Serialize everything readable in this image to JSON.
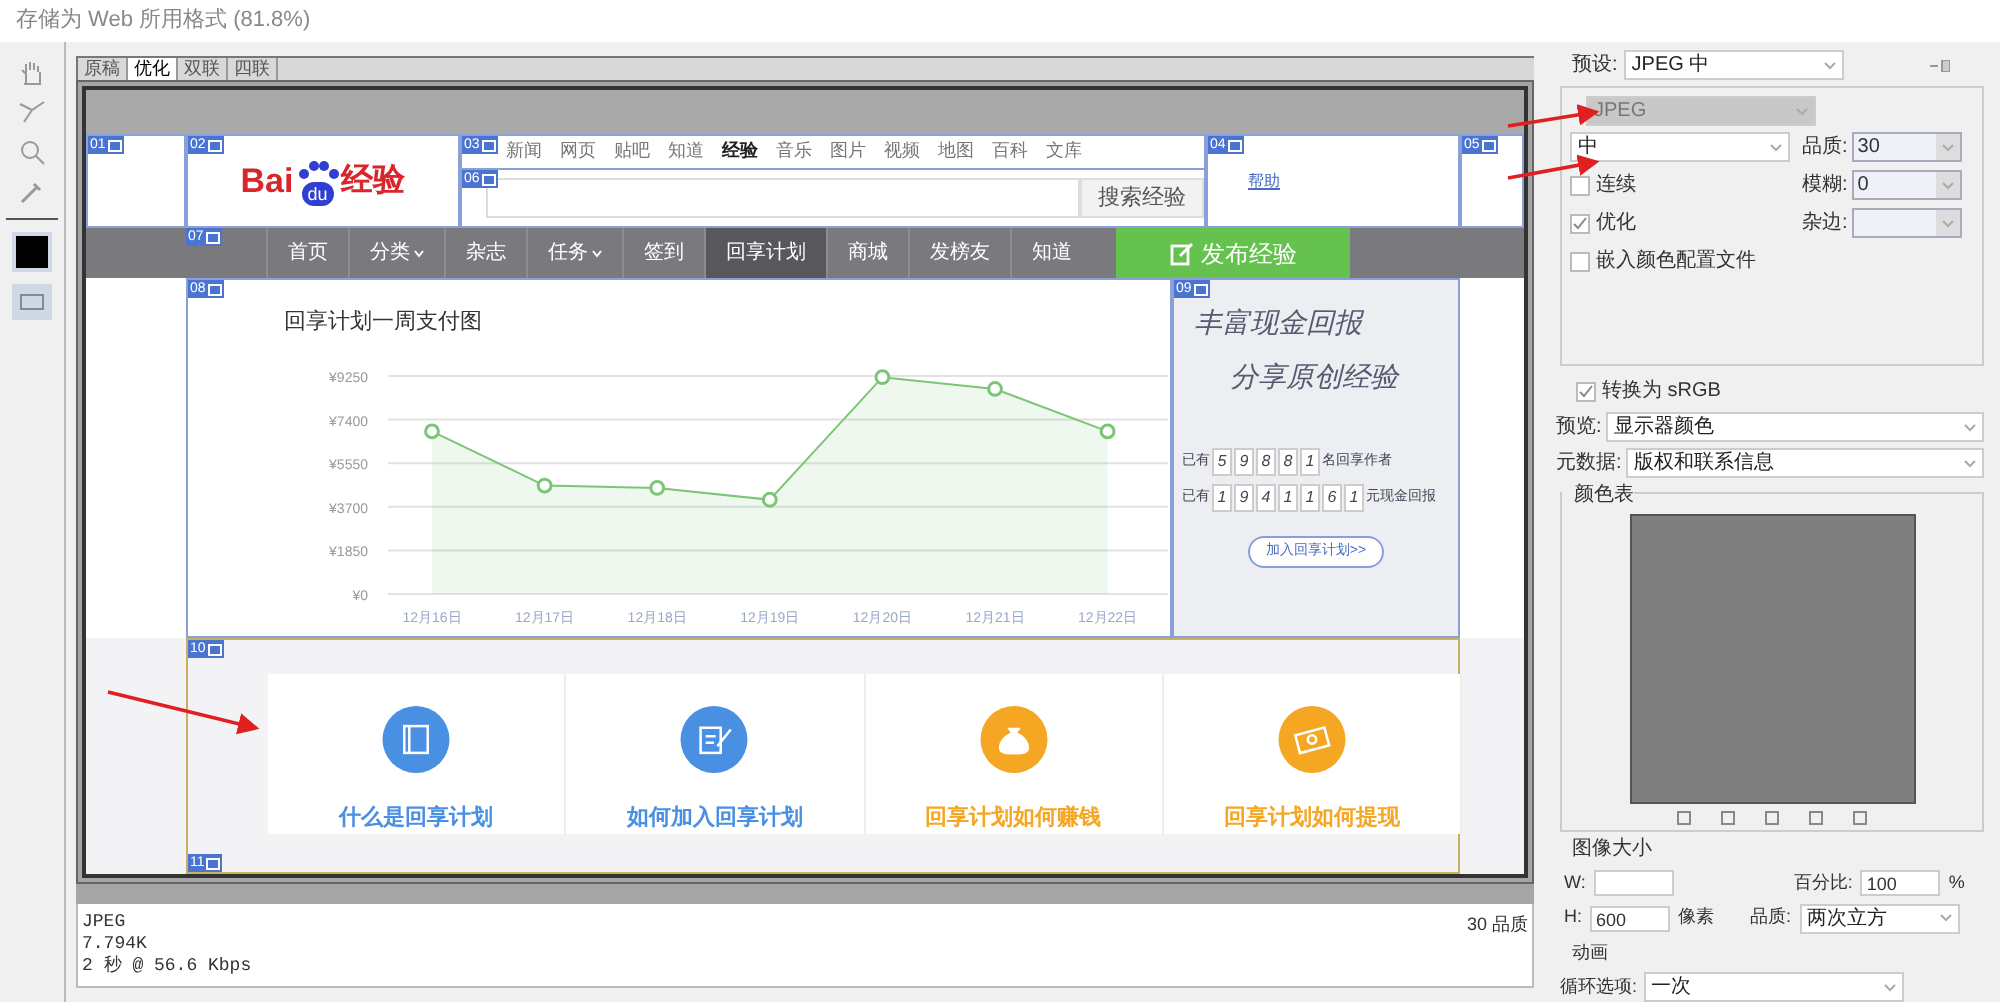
{
  "window": {
    "title": "存储为 Web 所用格式 (81.8%)"
  },
  "view_tabs": [
    {
      "label": "原稿",
      "selected": false
    },
    {
      "label": "优化",
      "selected": true
    },
    {
      "label": "双联",
      "selected": false
    },
    {
      "label": "四联",
      "selected": false
    }
  ],
  "slices": [
    "01",
    "02",
    "03",
    "06",
    "07",
    "08",
    "04",
    "05",
    "09",
    "10",
    "11"
  ],
  "page": {
    "logo": {
      "left": "Bai",
      "mark": "du",
      "right": "经验"
    },
    "top_links": [
      {
        "label": "新闻",
        "selected": false
      },
      {
        "label": "网页",
        "selected": false
      },
      {
        "label": "贴吧",
        "selected": false
      },
      {
        "label": "知道",
        "selected": false
      },
      {
        "label": "经验",
        "selected": true
      },
      {
        "label": "音乐",
        "selected": false
      },
      {
        "label": "图片",
        "selected": false
      },
      {
        "label": "视频",
        "selected": false
      },
      {
        "label": "地图",
        "selected": false
      },
      {
        "label": "百科",
        "selected": false
      },
      {
        "label": "文库",
        "selected": false
      }
    ],
    "search_button": "搜索经验",
    "help_link": "帮助",
    "nav": [
      {
        "label": "首页",
        "selected": false,
        "dropdown": false
      },
      {
        "label": "分类",
        "selected": false,
        "dropdown": true
      },
      {
        "label": "杂志",
        "selected": false,
        "dropdown": false
      },
      {
        "label": "任务",
        "selected": false,
        "dropdown": true
      },
      {
        "label": "签到",
        "selected": false,
        "dropdown": false
      },
      {
        "label": "回享计划",
        "selected": true,
        "dropdown": false
      },
      {
        "label": "商城",
        "selected": false,
        "dropdown": false
      },
      {
        "label": "发榜友",
        "selected": false,
        "dropdown": false
      },
      {
        "label": "知道",
        "selected": false,
        "dropdown": false
      }
    ],
    "publish_button": "发布经验",
    "chart": {
      "chart_data": {
        "type": "area",
        "title": "回享计划一周支付图",
        "categories": [
          "12月16日",
          "12月17日",
          "12月18日",
          "12月19日",
          "12月20日",
          "12月21日",
          "12月22日"
        ],
        "values": [
          6900,
          4600,
          4500,
          4000,
          9200,
          8700,
          6900
        ],
        "grid": true,
        "ylim": [
          0,
          9250
        ],
        "yticks": [
          {
            "value": 0,
            "label": "¥0"
          },
          {
            "value": 1850,
            "label": "¥1850"
          },
          {
            "value": 3700,
            "label": "¥3700"
          },
          {
            "value": 5550,
            "label": "¥5550"
          },
          {
            "value": 7400,
            "label": "¥7400"
          },
          {
            "value": 9250,
            "label": "¥9250"
          }
        ]
      }
    },
    "banner": {
      "headline": [
        "丰富现金回报",
        "分享原创经验"
      ],
      "stats": [
        {
          "prefix": "已有",
          "digits": [
            "5",
            "9",
            "8",
            "8",
            "1"
          ],
          "suffix": "名回享作者"
        },
        {
          "prefix": "已有",
          "digits": [
            "1",
            "9",
            "4",
            "1",
            "1",
            "6",
            "1"
          ],
          "suffix": "元现金回报"
        }
      ],
      "button": "加入回享计划>>"
    },
    "features": [
      {
        "label": "什么是回享计划",
        "kind": "book",
        "color": "#4a90e2"
      },
      {
        "label": "如何加入回享计划",
        "kind": "edit",
        "color": "#4a90e2"
      },
      {
        "label": "回享计划如何赚钱",
        "kind": "moneybag",
        "color": "#f5a623"
      },
      {
        "label": "回享计划如何提现",
        "kind": "cash",
        "color": "#f5a623"
      }
    ]
  },
  "info": {
    "lines": [
      "JPEG",
      "7.794K",
      "2 秒 @ 56.6 Kbps"
    ],
    "quality": "30 品质"
  },
  "settings": {
    "preset_label": "预设:",
    "preset": "JPEG 中",
    "format": {
      "value": "JPEG",
      "disabled": true
    },
    "quality_preset": "中",
    "checks": [
      {
        "label": "连续",
        "checked": false
      },
      {
        "label": "优化",
        "checked": true
      },
      {
        "label": "嵌入颜色配置文件",
        "checked": false
      }
    ],
    "fields": [
      {
        "label": "品质:",
        "value": "30"
      },
      {
        "label": "模糊:",
        "value": "0"
      },
      {
        "label": "杂边:"
      }
    ],
    "srgb": {
      "label": "转换为 sRGB",
      "checked": true
    },
    "preview": {
      "label": "预览:",
      "value": "显示器颜色"
    },
    "metadata": {
      "label": "元数据:",
      "value": "版权和联系信息"
    },
    "color_table": "颜色表",
    "image_size": {
      "title": "图像大小",
      "w_label": "W:",
      "h_label": "H:",
      "h_value": "600",
      "unit": "像素",
      "percent_label": "百分比:",
      "percent": "100",
      "percent_unit": "%",
      "quality_label": "品质:",
      "quality": "两次立方"
    },
    "animation": {
      "title": "动画",
      "loop_label": "循环选项:",
      "loop": "一次"
    }
  }
}
